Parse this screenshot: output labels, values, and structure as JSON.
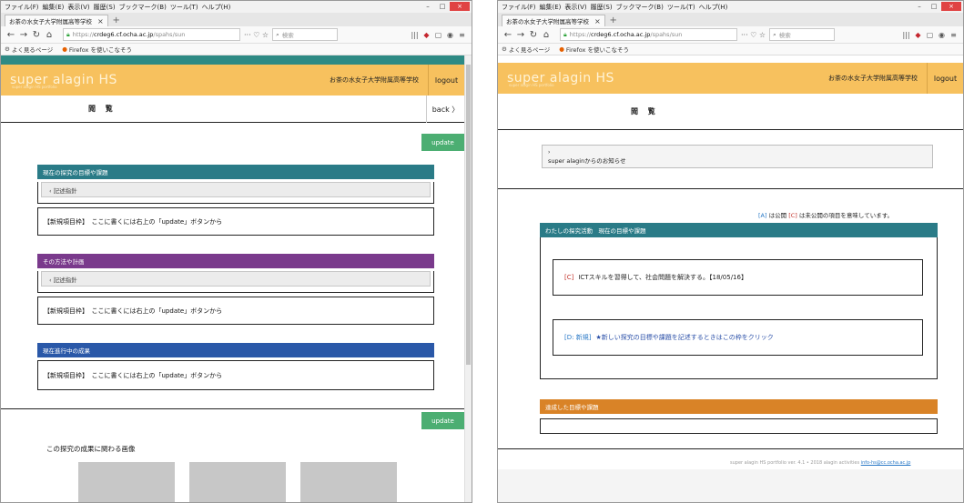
{
  "browser": {
    "menu": [
      "ファイル(F)",
      "編集(E)",
      "表示(V)",
      "履歴(S)",
      "ブックマーク(B)",
      "ツール(T)",
      "ヘルプ(H)"
    ],
    "window_controls": {
      "minimize": "–",
      "maximize": "□",
      "close": "×"
    },
    "tab_title": "お茶の水女子大学附属高等学校",
    "tab_close": "×",
    "new_tab": "+",
    "url_prefix": "https://",
    "url_host": "crdeg6.cf.ocha.ac.jp",
    "url_path": "/spahs/sun",
    "url_actions": "··· ♡ ☆",
    "search_placeholder": "検索",
    "bookmarks": [
      "よく見るページ",
      "Firefox を使いこなそう"
    ],
    "toolbar_icons": {
      "library": "|||",
      "pocket": "◆",
      "sidebar": "▢",
      "sync": "◉",
      "menu": "≡"
    }
  },
  "site": {
    "logo": "super alagin HS",
    "logo_sub": "super alagin HS portfolio",
    "school": "お茶の水女子大学附属高等学校",
    "logout": "logout",
    "subtitle": "閲 覧",
    "back": "back 〉",
    "update": "update"
  },
  "left": {
    "sections": [
      {
        "title": "現在の探究の目標や課題",
        "color": "#2a7b87",
        "note": "‹ 記述指針",
        "entry": "【新規項目枠】　ここに書くには右上の「update」ボタンから"
      },
      {
        "title": "その方法や計画",
        "color": "#7a3a8c",
        "note": "‹ 記述指針",
        "entry": "【新規項目枠】　ここに書くには右上の「update」ボタンから"
      },
      {
        "title": "現在進行中の成果",
        "color": "#2a58a8",
        "note": "",
        "entry": "【新規項目枠】　ここに書くには右上の「update」ボタンから"
      }
    ],
    "images_title": "この探究の成果に関わる画像"
  },
  "right": {
    "news_marker": "›",
    "news": "super alaginからのお知らせ",
    "legend": {
      "a_tag": "[A]",
      "a_text": "は公開",
      "c_tag": "[C]",
      "c_text": "は未公開の項目を意味しています。"
    },
    "section_title": "わたしの探究活動　現在の目標や課題",
    "section_color": "#2a7b87",
    "item1_tag": "[C]",
    "item1_text": "ICTスキルを習得して、社会問題を解決する。【18/05/16】",
    "item2_tag": "[D: 新規]",
    "item2_text": "★新しい探究の目標や課題を記述するときはこの枠をクリック",
    "section2_title": "達成した目標や課題",
    "section2_color": "#d98327",
    "footer_text": "super alagin HS portfolio ver. 4.1 • 2018 alagin activities",
    "footer_link": "info-hs@cc.ocha.ac.jp"
  }
}
